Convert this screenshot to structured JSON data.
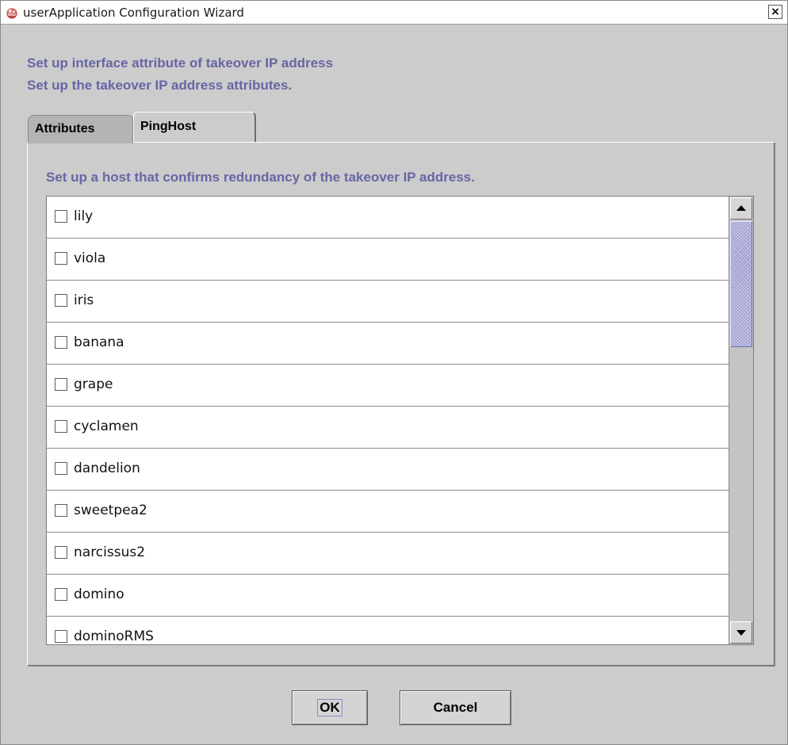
{
  "window": {
    "title": "userApplication Configuration Wizard",
    "close_glyph": "×",
    "icon": "app-icon"
  },
  "headings": {
    "line1": "Set up interface attribute of takeover IP address",
    "line2": "Set up the takeover IP address attributes."
  },
  "tabs": [
    {
      "label": "Attributes",
      "selected": false
    },
    {
      "label": "PingHost",
      "selected": true
    }
  ],
  "pinghost": {
    "description": "Set up a host that confirms redundancy of the takeover IP address.",
    "hosts": [
      {
        "label": "lily",
        "checked": false
      },
      {
        "label": "viola",
        "checked": false
      },
      {
        "label": "iris",
        "checked": false
      },
      {
        "label": "banana",
        "checked": false
      },
      {
        "label": "grape",
        "checked": false
      },
      {
        "label": "cyclamen",
        "checked": false
      },
      {
        "label": "dandelion",
        "checked": false
      },
      {
        "label": "sweetpea2",
        "checked": false
      },
      {
        "label": "narcissus2",
        "checked": false
      },
      {
        "label": "domino",
        "checked": false
      },
      {
        "label": "dominoRMS",
        "checked": false
      }
    ]
  },
  "buttons": {
    "ok_label": "OK",
    "cancel_label": "Cancel"
  },
  "colors": {
    "heading_text": "#6666a6",
    "scroll_thumb": "#9c9cd0"
  }
}
